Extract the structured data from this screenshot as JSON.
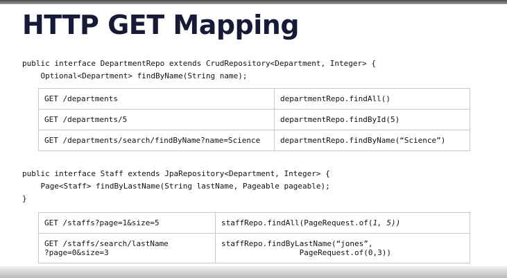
{
  "title": "HTTP GET Mapping",
  "department_repo": {
    "line1": "public interface DepartmentRepo extends CrudRepository<Department, Integer> {",
    "line2": "    Optional<Department> findByName(String name);"
  },
  "department_mappings": [
    {
      "request": "GET /departments",
      "method": "departmentRepo.findAll()"
    },
    {
      "request": "GET /departments/5",
      "method": "departmentRepo.findById(5)"
    },
    {
      "request": "GET /departments/search/findByName?name=Science",
      "method": "departmentRepo.findByName(“Science”)"
    }
  ],
  "staff_repo": {
    "line1": "public interface Staff extends JpaRepository<Department, Integer> {",
    "line2": "    Page<Staff> findByLastName(String lastName, Pageable pageable);",
    "line3": "}"
  },
  "staff_mappings": [
    {
      "request": "GET /staffs?page=1&size=5",
      "method_prefix": "staffRepo.findAll(PageRequest.of(",
      "method_args": "1, 5))"
    },
    {
      "request_line1": "GET /staffs/search/lastName",
      "request_line2": "?page=0&size=3",
      "method_line1": "staffRepo.findByLastName(“jones”,",
      "method_line2": "                 PageRequest.of(0,3))"
    }
  ]
}
